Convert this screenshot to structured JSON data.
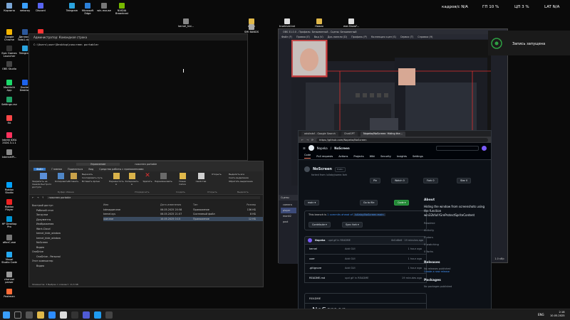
{
  "desktop": {
    "icons": [
      {
        "label": "Корзина"
      },
      {
        "label": "nekoray"
      },
      {
        "label": "Discord"
      },
      {
        "label": "Telegram"
      },
      {
        "label": "Microsoft Edge"
      },
      {
        "label": "win-mouse"
      },
      {
        "label": "NVIDIA Broadcast"
      },
      {
        "label": "Google Chrome"
      },
      {
        "label": "Дипломы Todo1.docx"
      },
      {
        "label": "Яндекс Музыка"
      },
      {
        "label": "Epic Games Launcher"
      },
      {
        "label": "Telegram"
      },
      {
        "label": "OBS Studio"
      },
      {
        "label": "Modrinth App"
      },
      {
        "label": "Docker Desktop"
      },
      {
        "label": "Settings.csv"
      },
      {
        "label": "EA"
      },
      {
        "label": "IntelliJ IDEA 2024.3.1.1"
      },
      {
        "label": "InternetPl..."
      },
      {
        "label": "Roblox Studio"
      },
      {
        "label": "Roblox Player"
      },
      {
        "label": "HP Desktop Pro"
      },
      {
        "label": "afterC.exe"
      },
      {
        "label": "Visual Studio Code"
      },
      {
        "label": "channel parser"
      },
      {
        "label": "Postman"
      },
      {
        "label": "kernel_hid..."
      },
      {
        "label": "nginx"
      },
      {
        "label": "truelevel.txt"
      },
      {
        "label": "Новая папка"
      },
      {
        "label": "exe.ShowF..."
      },
      {
        "label": "SMI BANDS"
      }
    ]
  },
  "perf": {
    "fps": "кадров/с N/A",
    "gpu": "ГП 10 %",
    "cpu": "ЦП 3 %",
    "lat": "LAT N/A"
  },
  "cmd": {
    "title": "Администратор: Командная строка",
    "line": "C:\\Users\\user\\Desktop\\noscreen portable>"
  },
  "explorer": {
    "title": "noscreen portable",
    "tab_manage": "Управление",
    "tabs": [
      "Файл",
      "Главная",
      "Поделиться",
      "Вид",
      "Средства работы с приложениями"
    ],
    "ribbon": {
      "pin": "Закрепить на панели быстрого доступа",
      "copy": "Копировать",
      "paste": "Вставить",
      "cut": "Вырезать",
      "copy_path": "Скопировать путь",
      "paste_shortcut": "Вставить ярлык",
      "clipboard": "Буфер обмена",
      "move_to": "Переместить в",
      "copy_to": "Копировать в",
      "delete": "Удалить",
      "rename": "Переименовать",
      "organize": "Упорядочить",
      "new_folder": "Новая папка",
      "create": "Создать",
      "properties": "Свойства",
      "open": "Открыть",
      "open_group": "Открыть",
      "select_all": "Выделить все",
      "select_none": "Снять выделение",
      "invert": "Обратить выделение",
      "select": "Выделить"
    },
    "address": "noscreen portable",
    "nav": [
      "Быстрый доступ",
      "Рабочий стол",
      "Загрузки",
      "Документы",
      "Изображения",
      "Work-Cloud",
      "kernel_hide_window",
      "kernel_hide_window",
      "NoScreen",
      "Видео",
      "OneDrive",
      "OneDrive - Personal",
      "Этот компьютер",
      "Видео"
    ],
    "columns": [
      "Имя",
      "Дата изменения",
      "Тип",
      "Размер"
    ],
    "files": [
      {
        "name": "kdmapper.exe",
        "date": "06.05.2025 20:58",
        "type": "Приложение",
        "size": "136 КБ"
      },
      {
        "name": "kernel.sys",
        "date": "06.05.2025 21:07",
        "type": "Системный файл",
        "size": "8 КБ"
      },
      {
        "name": "user.exe",
        "date": "10.05.2025 0:15",
        "type": "Приложение",
        "size": "12 КБ"
      }
    ],
    "status": "Элементов: 3    Выбран 1 элемент: 11,5 КБ"
  },
  "obs": {
    "title": "OBS 31.0.0 - Профиль: Безымянный - Сцены: Безымянный",
    "menu": [
      "Файл (F)",
      "Правка (E)",
      "Вид (V)",
      "Док-панели (D)",
      "Профиль (P)",
      "Коллекция сцен (S)",
      "Сервис (T)",
      "Справка (H)"
    ],
    "scenes_header": "Сцены",
    "scenes": [
      "camera",
      "player",
      "monit2",
      "post"
    ],
    "kbs": "1.0 кб/с"
  },
  "recording": {
    "label": "Запись запущена"
  },
  "browser": {
    "tabs": [
      "adsfadsf - Google Search",
      "ChatGPT",
      "Nopeka/NoScreen: Hiding the..."
    ],
    "url": "https://github.com/Nopeka/NoScreen",
    "gh": {
      "owner": "Nopeka",
      "repo": "NoScreen",
      "nav": [
        "Code",
        "Pull requests",
        "Actions",
        "Projects",
        "Wiki",
        "Security",
        "Insights",
        "Settings"
      ],
      "repo_name": "NoScreen",
      "visibility": "Public",
      "forked_from": "forked from lullaby/some-fork",
      "pin": "Pin",
      "watch": "Watch",
      "watch_count": "0",
      "fork": "Fork",
      "fork_count": "0",
      "star": "Star",
      "star_count": "0",
      "branch": "main",
      "go_to_file": "Go to file",
      "code_btn": "Code",
      "ahead_pre": "This branch is ",
      "ahead_link": "1 commits ahead of",
      "ahead_ref": "lullaby/NoScreen:main",
      "contribute": "Contribute",
      "sync": "Sync fork",
      "commit_user": "Nopeka",
      "commit_msg": "upd gif in README",
      "commit_hash": "6d1d8e6 · 19 minutes ago",
      "files": [
        {
          "name": "kernel",
          "msg": "Add GUI",
          "time": "1 hour ago"
        },
        {
          "name": "user",
          "msg": "Add GUI",
          "time": "1 hour ago"
        },
        {
          "name": ".gitignore",
          "msg": "Add GUI",
          "time": "1 hour ago"
        },
        {
          "name": "README.md",
          "msg": "upd gif in README",
          "time": "19 minutes ago"
        }
      ],
      "about": "About",
      "about_text": "Hiding the window from screenshots using the function win32kfull!GreProtectSpriteContent",
      "side_links": [
        "Readme",
        "Activity",
        "0 stars",
        "0 watching",
        "0 forks"
      ],
      "releases": "Releases",
      "no_releases": "No releases published",
      "create_release": "Create a new release",
      "packages": "Packages",
      "no_packages": "No packages published",
      "readme_tab": "README",
      "readme_heading": "NoScreen"
    }
  },
  "taskbar": {
    "lang": "ENG",
    "time": "2:18",
    "date": "10.05.2025"
  },
  "colors": {
    "accent_blue": "#4493f8",
    "gh_green": "#238636",
    "rec_red": "#e03030"
  }
}
